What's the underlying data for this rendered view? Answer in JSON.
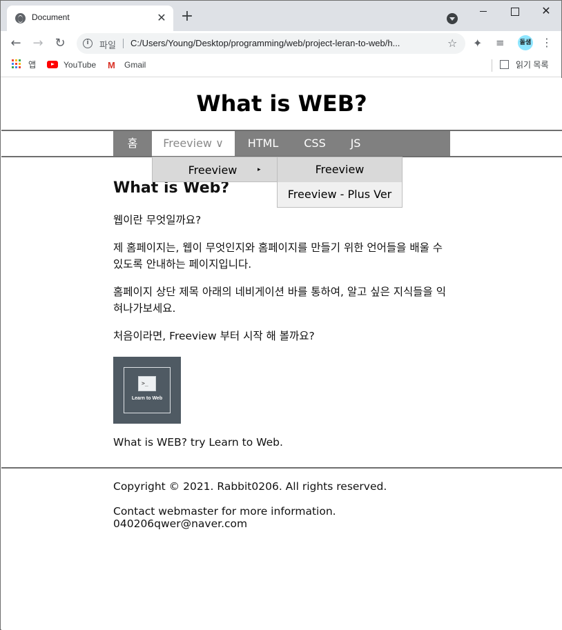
{
  "browser": {
    "tab_title": "Document",
    "tab_close": "✕",
    "new_tab": "+",
    "window_close": "✕",
    "url_scheme": "파일",
    "url": "C:/Users/Young/Desktop/programming/web/project-leran-to-web/h...",
    "avatar_text": "돌샘",
    "bookmarks": {
      "apps_label": "앱",
      "youtube_label": "YouTube",
      "gmail_label": "Gmail",
      "reading_list_label": "읽기 목록"
    },
    "icons": [
      "globe-icon",
      "close-icon",
      "plus-icon",
      "back-icon",
      "forward-icon",
      "reload-icon",
      "info-icon",
      "star-icon",
      "puzzle-icon",
      "media-icon",
      "kebab-menu-icon",
      "apps-grid-icon",
      "youtube-icon",
      "gmail-icon",
      "reading-list-icon"
    ]
  },
  "site": {
    "title": "What is WEB?",
    "nav": {
      "home": "홈",
      "freeview": "Freeview ∨",
      "html": "HTML",
      "css": "CSS",
      "js": "JS"
    },
    "dropdown": {
      "level1": "Freeview",
      "level1_arrow": "▸",
      "level2": [
        "Freeview",
        "Freeview - Plus Ver"
      ]
    },
    "content": {
      "heading": "What is Web?",
      "paragraphs": [
        "웹이란 무엇일까요?",
        "제 홈페이지는, 웹이 무엇인지와 홈페이지를 만들기 위한 언어들을 배울 수 있도록 안내하는 페이지입니다.",
        "홈페이지 상단 제목 아래의 네비게이션 바를 통하여, 알고 싶은 지식들을 익혀나가보세요.",
        "처음이라면, Freeview 부터 시작 해 볼까요?"
      ],
      "image_label": "Learn to Web",
      "image_prompt": ">_",
      "caption": "What is WEB? try Learn to Web."
    },
    "footer": {
      "copyright": "Copyright © 2021. Rabbit0206. All rights reserved.",
      "contact": "Contact webmaster for more information.",
      "email": "040206qwer@naver.com"
    }
  }
}
